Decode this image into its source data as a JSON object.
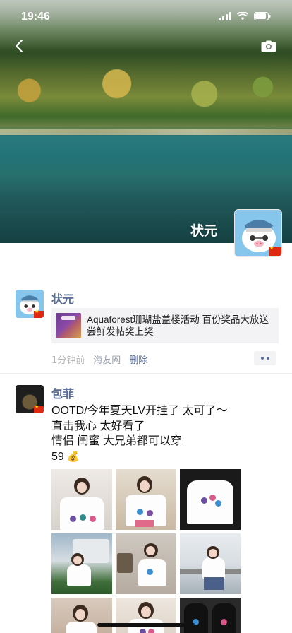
{
  "status_bar": {
    "time": "19:46"
  },
  "cover": {
    "profile_name": "状元",
    "back_icon": "chevron-left-icon",
    "camera_icon": "camera-icon"
  },
  "posts": [
    {
      "author": "状元",
      "shared_link": {
        "title": "Aquaforest珊瑚盐盖楼活动 百份奖品大放送尝鲜发帖奖上奖"
      },
      "time": "1分钟前",
      "source": "海友网",
      "delete_label": "删除"
    },
    {
      "author": "包菲",
      "text_lines": [
        "OOTD/今年夏天LV开挂了 太可了～",
        "直击我心 太好看了",
        "情侣 闺蜜 大兄弟都可以穿",
        "59"
      ],
      "money_icon": "💰"
    }
  ],
  "colors": {
    "link_blue": "#576b95",
    "meta_gray": "#b2b2b2",
    "card_bg": "#f3f3f5"
  }
}
